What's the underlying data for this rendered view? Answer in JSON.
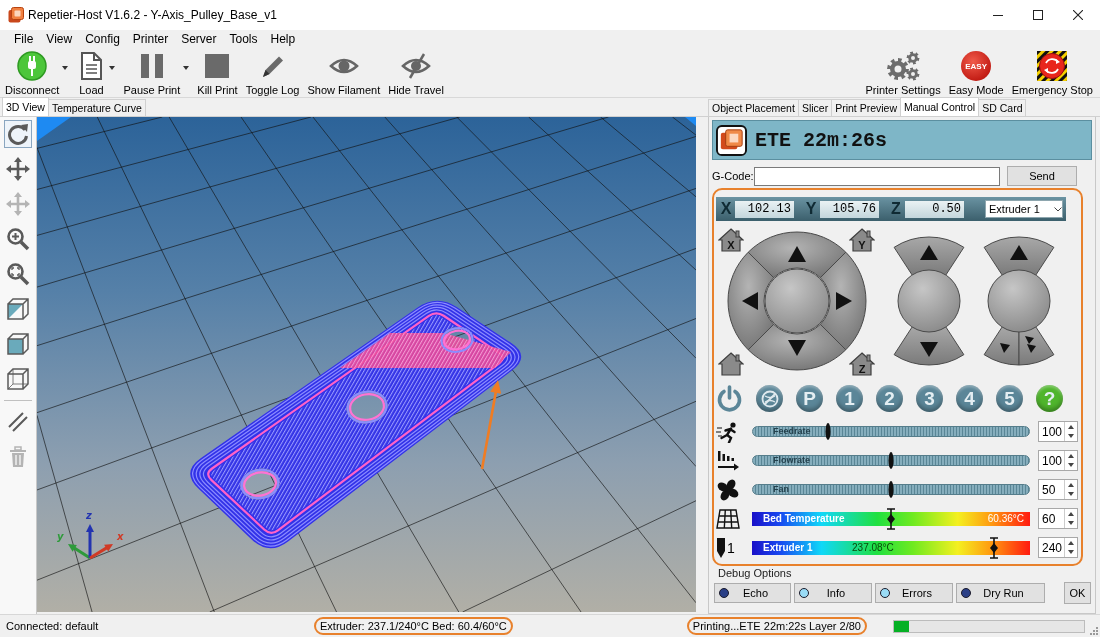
{
  "window": {
    "title": "Repetier-Host V1.6.2 - Y-Axis_Pulley_Base_v1"
  },
  "menu": [
    "File",
    "View",
    "Config",
    "Printer",
    "Server",
    "Tools",
    "Help"
  ],
  "toolbar": {
    "left": [
      {
        "label": "Disconnect",
        "dropdown": true
      },
      {
        "label": "Load",
        "dropdown": true
      },
      {
        "label": "Pause Print",
        "dropdown": true
      },
      {
        "label": "Kill Print",
        "dropdown": false
      },
      {
        "label": "Toggle Log",
        "dropdown": false
      },
      {
        "label": "Show Filament",
        "dropdown": false
      },
      {
        "label": "Hide Travel",
        "dropdown": false
      }
    ],
    "right": [
      {
        "label": "Printer Settings"
      },
      {
        "label": "Easy Mode",
        "badge": "EASY"
      },
      {
        "label": "Emergency Stop"
      }
    ]
  },
  "left_tabs": [
    {
      "label": "3D View",
      "selected": true
    },
    {
      "label": "Temperature Curve",
      "selected": false
    }
  ],
  "view_tools": [
    {
      "selected": true,
      "disabled": false
    },
    {
      "selected": false,
      "disabled": false
    },
    {
      "selected": false,
      "disabled": true
    },
    {
      "selected": false,
      "disabled": false
    },
    {
      "selected": false,
      "disabled": false
    },
    {
      "selected": false,
      "disabled": false
    },
    {
      "selected": false,
      "disabled": false
    },
    {
      "selected": false,
      "disabled": false
    }
  ],
  "edit_tools": [
    {
      "disabled": false
    },
    {
      "disabled": true
    }
  ],
  "view3d": {
    "axes": [
      {
        "label": "y",
        "color": "#2e9a3a"
      },
      {
        "label": "z",
        "color": "#2233b0"
      },
      {
        "label": "x",
        "color": "#d03a26"
      }
    ],
    "annotation_arrow": true
  },
  "right_tabs": [
    {
      "label": "Object Placement",
      "selected": false
    },
    {
      "label": "Slicer",
      "selected": false
    },
    {
      "label": "Print Preview",
      "selected": false
    },
    {
      "label": "Manual Control",
      "selected": true
    },
    {
      "label": "SD Card",
      "selected": false
    }
  ],
  "manual_control": {
    "ete": "ETE 22m:26s",
    "gcode": {
      "label": "G-Code:",
      "button": "Send"
    },
    "highlighted": true,
    "coordinates": [
      {
        "axis": "X",
        "value": "102.13"
      },
      {
        "axis": "Y",
        "value": "105.76"
      },
      {
        "axis": "Z",
        "value": "0.50"
      }
    ],
    "extruder_select": "Extruder 1",
    "home_labels": [
      "X",
      "Y",
      "Z"
    ],
    "function_buttons": [
      {
        "kind": "glyph",
        "color": "#5b8698"
      },
      {
        "kind": "icon",
        "color": "#5b8698"
      },
      {
        "kind": "label",
        "label": "P",
        "color": "#5b8698"
      },
      {
        "kind": "label",
        "label": "1",
        "color": "#5b8698"
      },
      {
        "kind": "label",
        "label": "2",
        "color": "#5b8698"
      },
      {
        "kind": "label",
        "label": "3",
        "color": "#5b8698"
      },
      {
        "kind": "label",
        "label": "4",
        "color": "#5b8698"
      },
      {
        "kind": "label",
        "label": "5",
        "color": "#5b8698"
      },
      {
        "kind": "label",
        "label": "?",
        "color": "#4fb52c"
      }
    ],
    "sliders": [
      {
        "kind": "slider",
        "label": "Feedrate",
        "level": 0.27,
        "value": "100"
      },
      {
        "kind": "slider",
        "label": "Flowrate",
        "level": 0.5,
        "value": "100"
      },
      {
        "kind": "slider",
        "label": "Fan",
        "level": 0.5,
        "value": "50"
      },
      {
        "kind": "temperature",
        "label": "Bed Temperature",
        "reading": "60.36°C",
        "level": 0.5,
        "value": "60"
      },
      {
        "kind": "temperature",
        "label": "Extruder 1",
        "tool_number": "1",
        "reading": "237.08°C",
        "level": 0.87,
        "value": "240"
      }
    ],
    "debug": {
      "title": "Debug Options",
      "buttons": [
        {
          "label": "Echo",
          "on": false
        },
        {
          "label": "Info",
          "on": true
        },
        {
          "label": "Errors",
          "on": true
        },
        {
          "label": "Dry Run",
          "on": false
        }
      ],
      "ok": "OK"
    }
  },
  "status_bar": {
    "items": [
      {
        "text": "Connected: default",
        "highlighted": false
      },
      {
        "text": "Extruder: 237.1/240°C Bed: 60.4/60°C",
        "highlighted": true
      },
      {
        "text": "Printing...ETE 22m:22s Layer 2/80",
        "highlighted": true
      }
    ],
    "progress": {
      "level": 0.08
    }
  }
}
